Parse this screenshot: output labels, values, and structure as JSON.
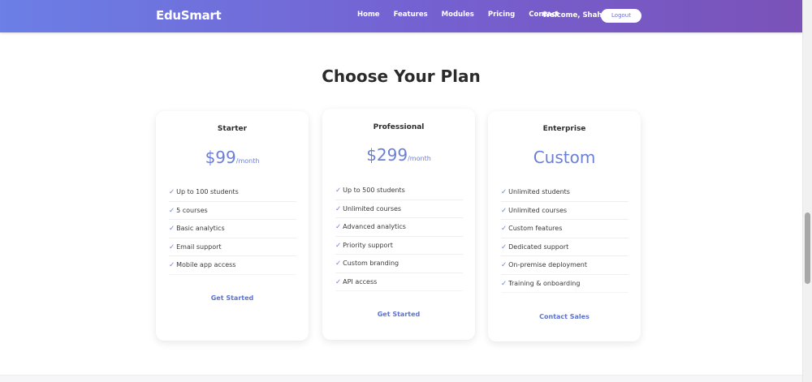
{
  "navbar": {
    "brand": "EduSmart",
    "links": [
      "Home",
      "Features",
      "Modules",
      "Pricing",
      "Contact"
    ],
    "welcome": "Welcome, Shahd",
    "logout_label": "Logout"
  },
  "pricing": {
    "title": "Choose Your Plan",
    "plans": [
      {
        "name": "Starter",
        "price": "$99",
        "period": "/month",
        "features": [
          "Up to 100 students",
          "5 courses",
          "Basic analytics",
          "Email support",
          "Mobile app access"
        ],
        "cta": "Get Started"
      },
      {
        "name": "Professional",
        "price": "$299",
        "period": "/month",
        "features": [
          "Up to 500 students",
          "Unlimited courses",
          "Advanced analytics",
          "Priority support",
          "Custom branding",
          "API access"
        ],
        "cta": "Get Started"
      },
      {
        "name": "Enterprise",
        "price": "Custom",
        "period": "",
        "features": [
          "Unlimited students",
          "Unlimited courses",
          "Custom features",
          "Dedicated support",
          "On-premise deployment",
          "Training & onboarding"
        ],
        "cta": "Contact Sales"
      }
    ]
  },
  "icons": {
    "check": "✓"
  },
  "colors": {
    "accent": "#6b7fd6",
    "nav_gradient_start": "#6b7fe6",
    "nav_gradient_end": "#7a52b8"
  }
}
